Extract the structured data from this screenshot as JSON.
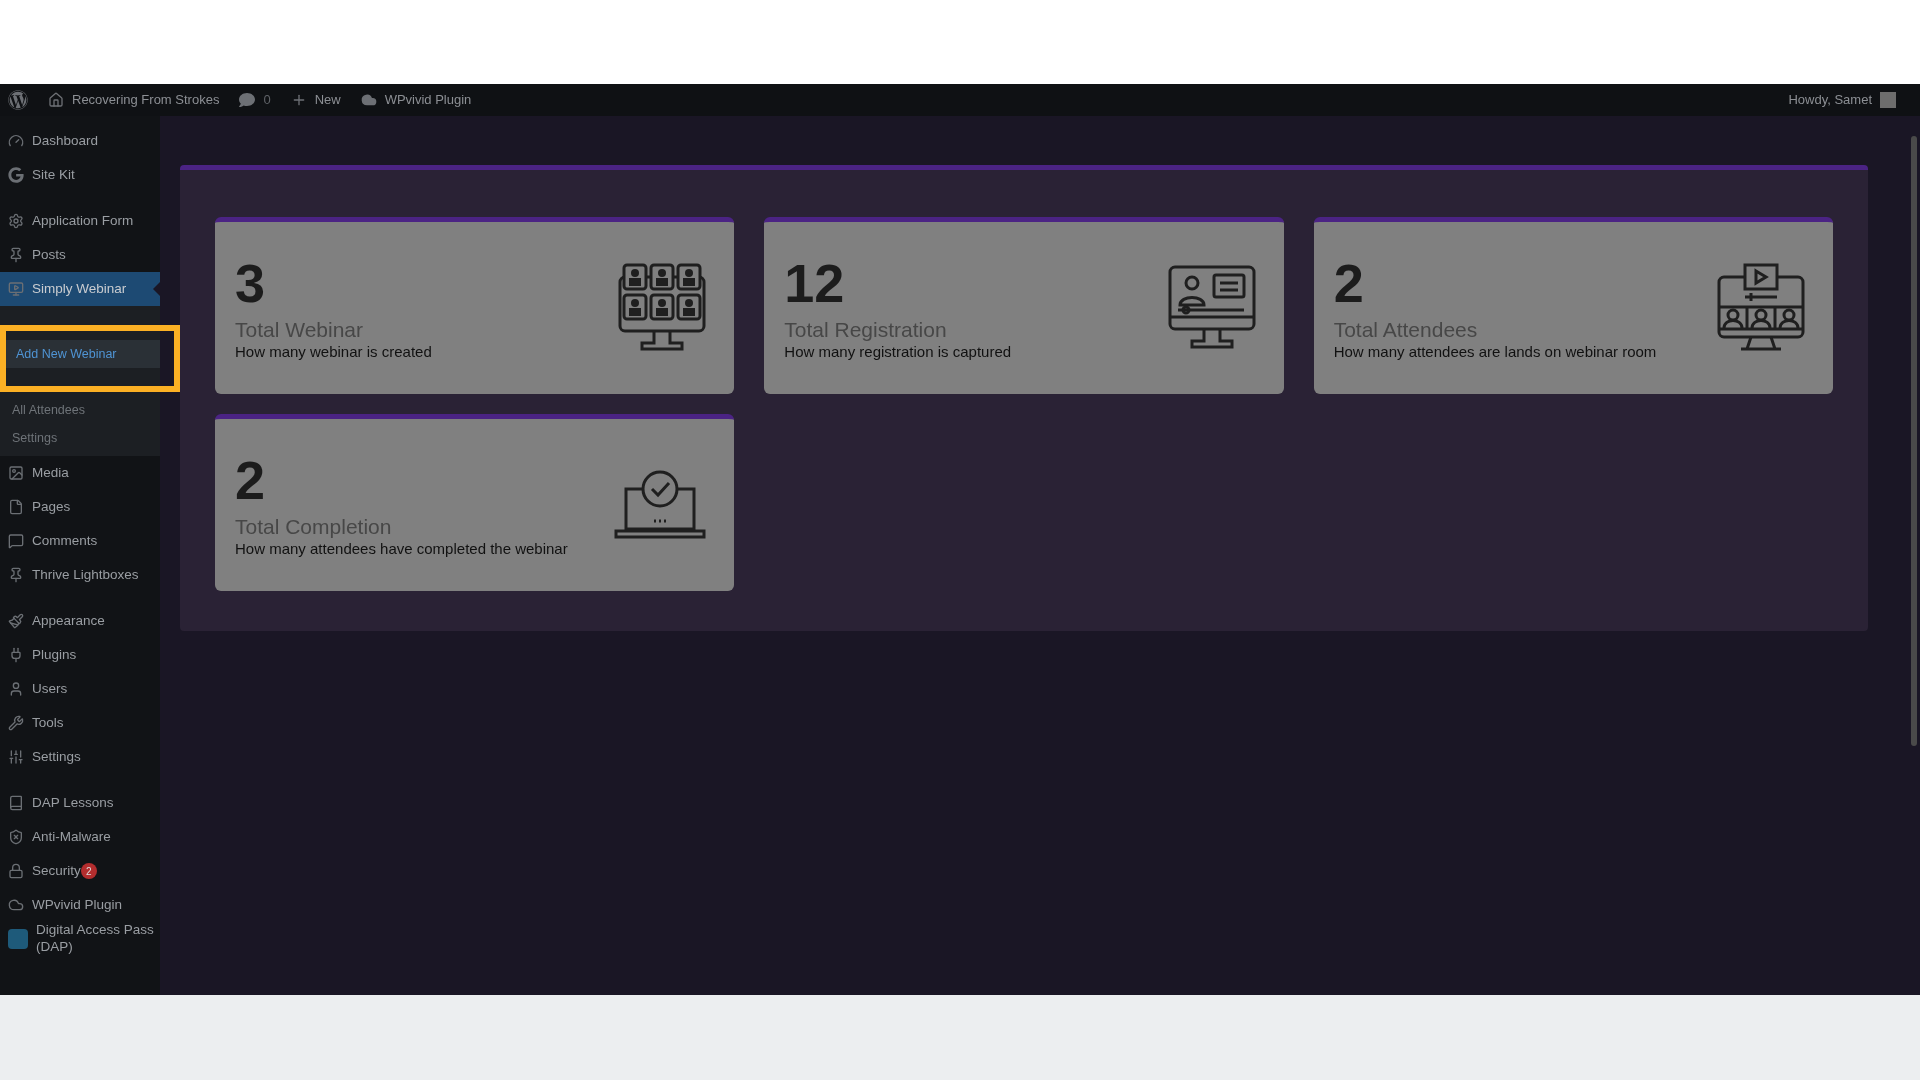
{
  "admin_bar": {
    "site": "Recovering From Strokes",
    "comments": "0",
    "new": "New",
    "plugin": "WPvivid Plugin",
    "greeting": "Howdy, Samet"
  },
  "sidebar": {
    "groups": [
      [
        {
          "label": "Dashboard",
          "selected": false
        },
        {
          "label": "Site Kit",
          "selected": false
        }
      ],
      [
        {
          "label": "Application Form",
          "selected": false
        },
        {
          "label": "Posts",
          "selected": false
        },
        {
          "label": "Simply Webinar",
          "selected": true,
          "children": [
            {
              "label": "Add New Webinar",
              "selected": true
            },
            {
              "label": "All Attendees",
              "selected": false
            },
            {
              "label": "Settings",
              "selected": false
            }
          ]
        },
        {
          "label": "Media",
          "selected": false
        },
        {
          "label": "Pages",
          "selected": false
        },
        {
          "label": "Comments",
          "selected": false
        },
        {
          "label": "Thrive Lightboxes",
          "selected": false
        }
      ],
      [
        {
          "label": "Appearance",
          "selected": false
        },
        {
          "label": "Plugins",
          "selected": false
        },
        {
          "label": "Users",
          "selected": false
        },
        {
          "label": "Tools",
          "selected": false
        },
        {
          "label": "Settings",
          "selected": false
        }
      ],
      [
        {
          "label": "DAP Lessons",
          "selected": false
        },
        {
          "label": "Anti-Malware",
          "selected": false
        },
        {
          "label": "Security",
          "selected": false,
          "badge": "2"
        },
        {
          "label": "WPvivid Plugin",
          "selected": false
        },
        {
          "label": "Digital Access Pass (DAP)",
          "selected": false
        }
      ]
    ]
  },
  "stats": [
    {
      "value": "3",
      "title": "Total Webinar",
      "description": "How many webinar is created"
    },
    {
      "value": "12",
      "title": "Total Registration",
      "description": "How many registration is captured"
    },
    {
      "value": "2",
      "title": "Total Attendees",
      "description": "How many attendees are lands on webinar room"
    },
    {
      "value": "2",
      "title": "Total Completion",
      "description": "How many attendees have completed the webinar"
    }
  ]
}
